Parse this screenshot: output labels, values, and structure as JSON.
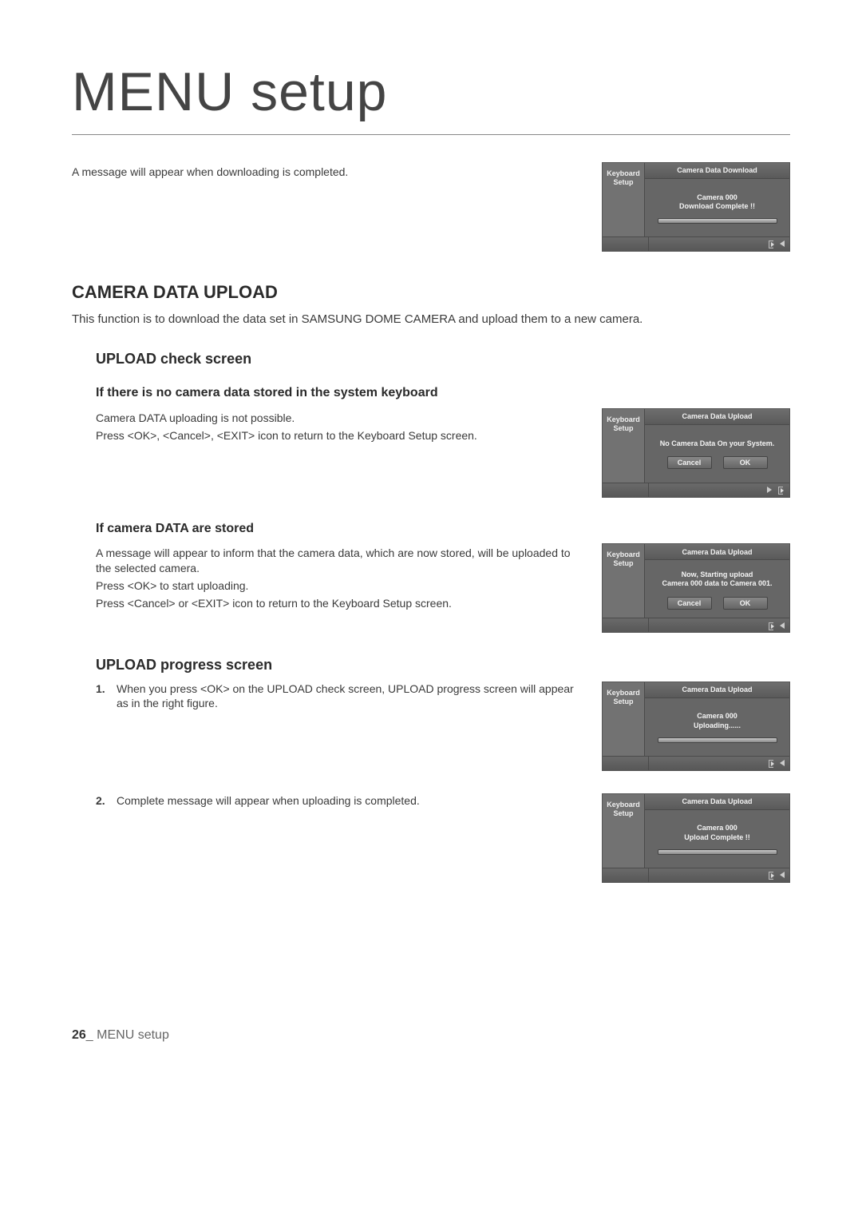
{
  "page": {
    "title": "MENU setup",
    "number": "26",
    "footer_label": "MENU setup"
  },
  "sections": {
    "download_complete": {
      "text": "A message will appear when downloading is completed."
    },
    "upload": {
      "heading": "CAMERA DATA UPLOAD",
      "description": "This function is to download the data set in SAMSUNG DOME CAMERA and upload them to a new camera.",
      "check_screen_heading": "UPLOAD check screen",
      "no_data": {
        "heading": "If there is no camera data stored in the system keyboard",
        "line1": "Camera DATA uploading is not possible.",
        "line2": "Press <OK>, <Cancel>, <EXIT> icon to return to the Keyboard Setup screen."
      },
      "data_stored": {
        "heading": "If camera DATA are stored",
        "line1": "A message will appear to inform that the camera data, which are now stored, will be uploaded to the selected camera.",
        "line2": "Press <OK> to start uploading.",
        "line3": "Press <Cancel> or <EXIT> icon to return to the Keyboard Setup screen."
      },
      "progress_heading": "UPLOAD progress screen",
      "step1": "When you press <OK> on the UPLOAD check screen, UPLOAD progress screen will appear as in the right figure.",
      "step2": "Complete message will appear when uploading is completed."
    }
  },
  "mini": {
    "sidebar_line1": "Keyboard",
    "sidebar_line2": "Setup",
    "btn_cancel": "Cancel",
    "btn_ok": "OK",
    "download": {
      "header": "Camera Data Download",
      "msg_line1": "Camera 000",
      "msg_line2": "Download Complete !!"
    },
    "upload_nodata": {
      "header": "Camera Data Upload",
      "msg": "No Camera Data On your System."
    },
    "upload_confirm": {
      "header": "Camera Data Upload",
      "msg_line1": "Now, Starting upload",
      "msg_line2": "Camera 000 data to Camera 001."
    },
    "upload_progress": {
      "header": "Camera Data Upload",
      "msg_line1": "Camera 000",
      "msg_line2": "Uploading......"
    },
    "upload_done": {
      "header": "Camera Data Upload",
      "msg_line1": "Camera 000",
      "msg_line2": "Upload Complete !!"
    }
  }
}
